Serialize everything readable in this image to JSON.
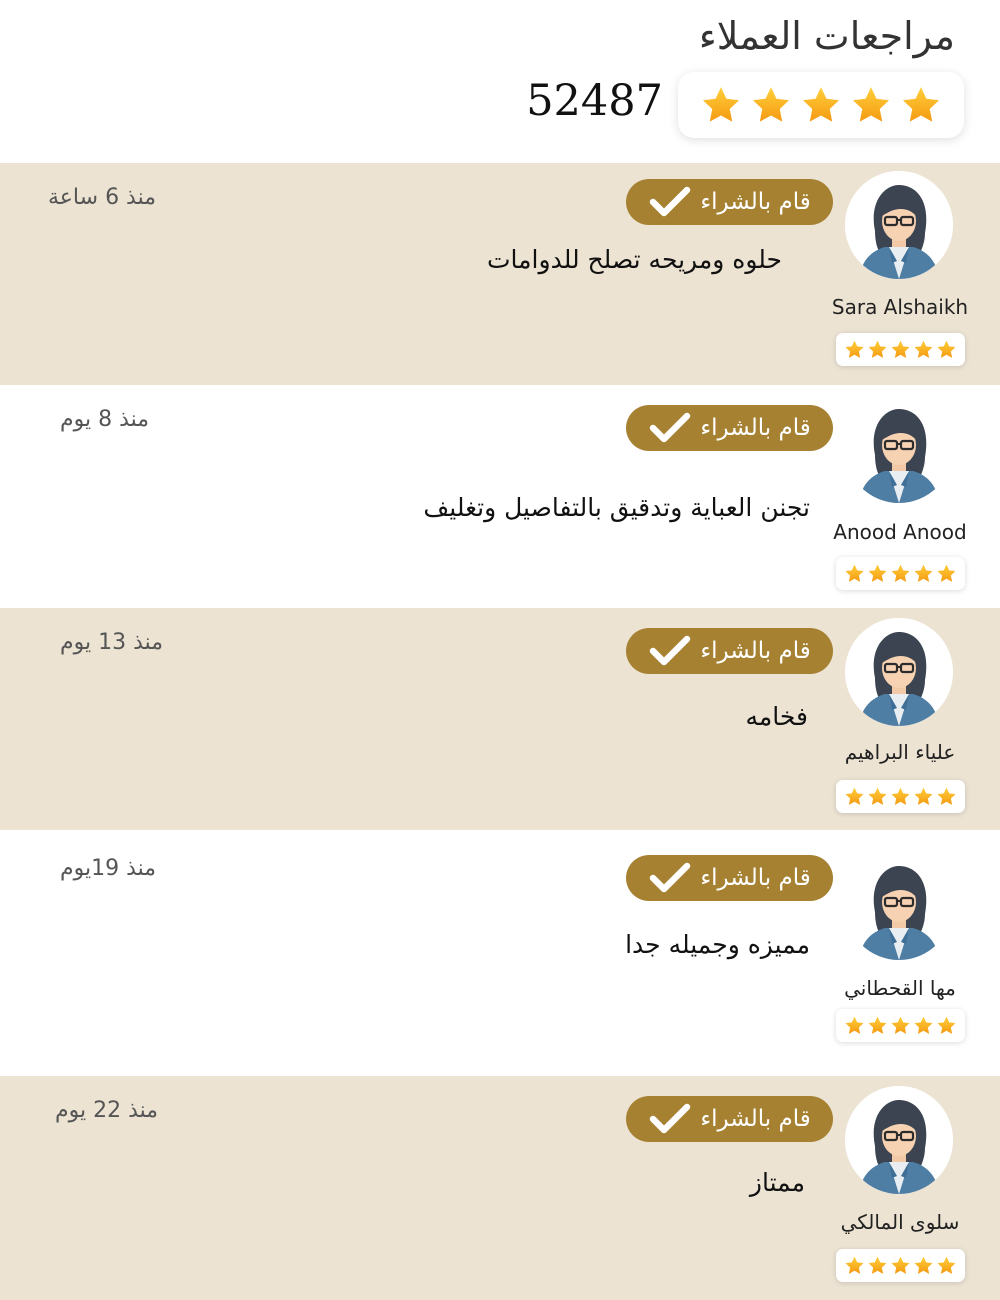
{
  "header": {
    "title": "مراجعات العملاء",
    "rating_stars": 5,
    "review_count": "52487"
  },
  "colors": {
    "accent": "#a68132",
    "row_beige": "#ece3d3",
    "star": "#f7a81b"
  },
  "icons": {
    "star": "star-icon",
    "check": "check-icon",
    "avatar": "female-user-avatar"
  },
  "reviews": [
    {
      "name": "Sara Alshaikh",
      "rating": 5,
      "badge": "قام بالشراء",
      "text": "حلوه ومريحه تصلح للدوامات",
      "time": "منذ 6 ساعة"
    },
    {
      "name": "Anood Anood",
      "rating": 5,
      "badge": "قام بالشراء",
      "text": "تجنن العباية وتدقيق بالتفاصيل وتغليف",
      "time": "منذ 8 يوم"
    },
    {
      "name": "علياء البراهيم",
      "rating": 5,
      "badge": "قام بالشراء",
      "text": "فخامه",
      "time": "منذ 13 يوم"
    },
    {
      "name": "مها القحطاني",
      "rating": 5,
      "badge": "قام بالشراء",
      "text": "مميزه وجميله جدا",
      "time": "منذ 19يوم"
    },
    {
      "name": "سلوى المالكي",
      "rating": 5,
      "badge": "قام بالشراء",
      "text": "ممتاز",
      "time": "منذ 22 يوم"
    }
  ]
}
